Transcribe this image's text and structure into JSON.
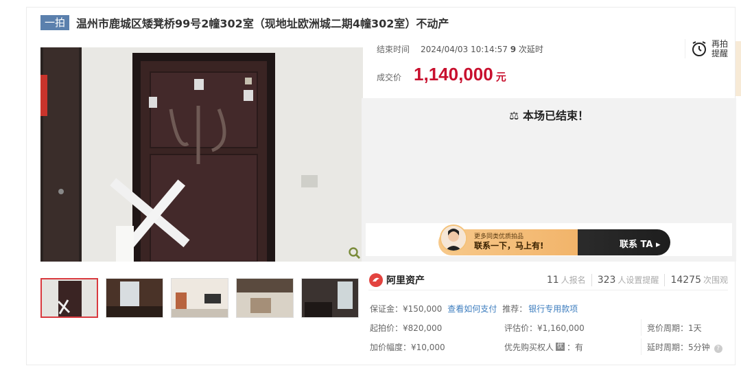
{
  "auction": {
    "round_badge": "一拍",
    "title": "温州市鹿城区矮凳桥99号2幢302室（现地址欧洲城二期4幢302室）不动产"
  },
  "status": {
    "end_time_label": "结束时间",
    "end_time": "2024/04/03 10:14:57",
    "delay_count": "9",
    "delay_text": "次延时",
    "deal_price_label": "成交价",
    "deal_price": "1,140,000",
    "deal_price_unit": "元",
    "remind_line1": "再拍",
    "remind_line2": "提醒",
    "ended_message": "本场已结束！"
  },
  "promo": {
    "line1": "更多同类优质拍品",
    "line2": "联系一下，马上有!",
    "button": "联系 TA ▸"
  },
  "stats": {
    "brand": "阿里资产",
    "signup_count": "11",
    "signup_label": "人报名",
    "remind_count": "323",
    "remind_label": "人设置提醒",
    "view_count": "14275",
    "view_label": "次围观"
  },
  "details": {
    "deposit": "保证金：¥150,000",
    "how_to_pay": "查看如何支付",
    "recommend_label": "推荐：",
    "recommend_link": "银行专用款项",
    "start_price": "起拍价：¥820,000",
    "appraisal": "评估价：¥1,160,000",
    "cycle": "竞价周期：1天",
    "increment": "加价幅度：¥10,000",
    "priority_label": "优先购买权人",
    "priority_badge": "优",
    "priority_value": "：有",
    "delay_period": "延时周期：5分钟"
  },
  "colors": {
    "price": "#c8102e",
    "badge": "#5b80ad",
    "link": "#3e7ebf"
  }
}
